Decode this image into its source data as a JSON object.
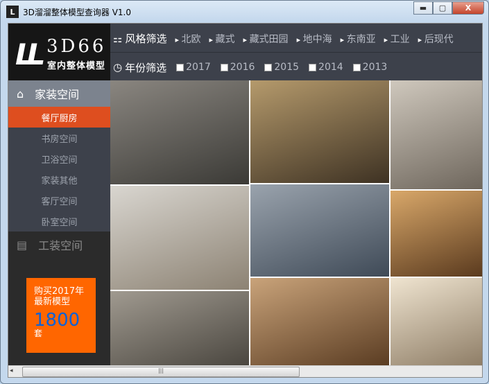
{
  "window": {
    "title": "3D溜溜整体模型查询器 V1.0",
    "minimize": "▬",
    "maximize": "▢",
    "close": "X"
  },
  "brand": {
    "logo_mark": "LL",
    "name": "3D66",
    "subtitle": "室内整体模型"
  },
  "style_filter": {
    "label": "风格筛选",
    "items": [
      "北欧",
      "藏式",
      "藏式田园",
      "地中海",
      "东南亚",
      "工业",
      "后现代"
    ]
  },
  "year_filter": {
    "label": "年份筛选",
    "years": [
      "2017",
      "2016",
      "2015",
      "2014",
      "2013"
    ]
  },
  "sidebar": {
    "section1": {
      "label": "家装空间",
      "icon": "home-icon"
    },
    "items": [
      {
        "label": "餐厅厨房",
        "active": true
      },
      {
        "label": "书房空间"
      },
      {
        "label": "卫浴空间"
      },
      {
        "label": "家装其他"
      },
      {
        "label": "客厅空间"
      },
      {
        "label": "卧室空间"
      }
    ],
    "section2": {
      "label": "工装空间",
      "icon": "list-icon"
    }
  },
  "promo": {
    "text": "购买2017年最新模型",
    "count": "1800",
    "unit": "套"
  },
  "colors": {
    "accent": "#de4e1f",
    "promo": "#ff6600",
    "count": "#0a62d8"
  }
}
